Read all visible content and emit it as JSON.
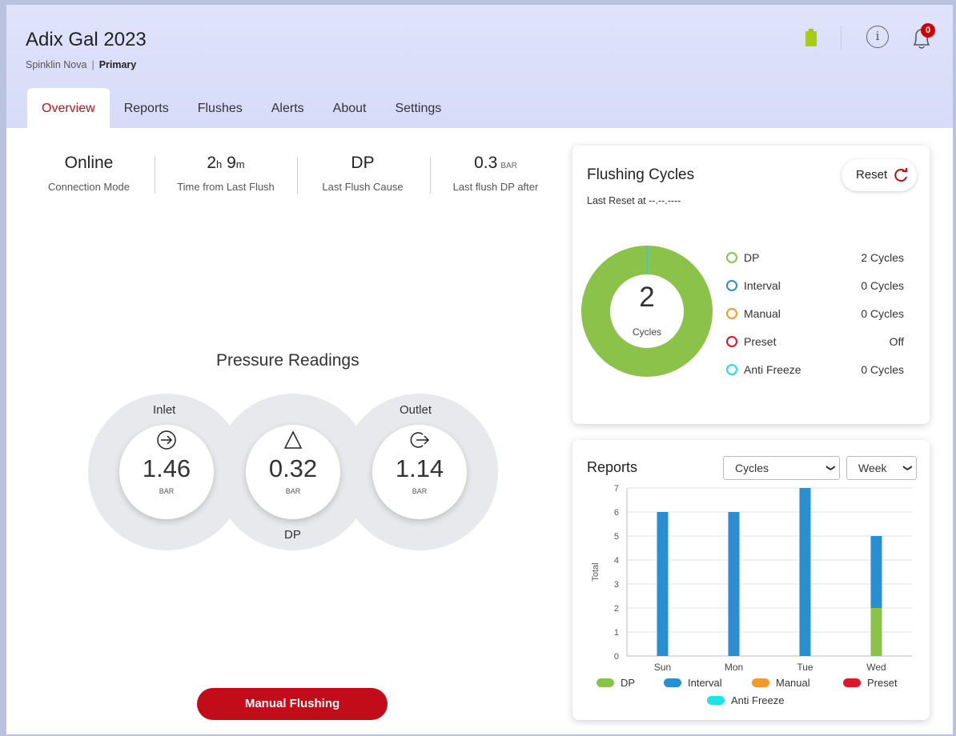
{
  "header": {
    "title": "Adix Gal 2023",
    "subtitle_device": "Spinklin Nova",
    "subtitle_sep": "|",
    "subtitle_role": "Primary",
    "info_glyph": "i",
    "notification_count": "0"
  },
  "tabs": [
    {
      "label": "Overview",
      "active": true
    },
    {
      "label": "Reports"
    },
    {
      "label": "Flushes"
    },
    {
      "label": "Alerts"
    },
    {
      "label": "About"
    },
    {
      "label": "Settings"
    }
  ],
  "stats": {
    "connection": {
      "value": "Online",
      "label": "Connection Mode"
    },
    "last_flush_time": {
      "hours": "2",
      "h_unit": "h",
      "minutes": "9",
      "m_unit": "m",
      "label": "Time from Last Flush"
    },
    "last_flush_cause": {
      "value": "DP",
      "label": "Last Flush Cause"
    },
    "last_flush_dp": {
      "value": "0.3",
      "unit": "BAR",
      "label": "Last flush DP after"
    }
  },
  "pressure": {
    "title": "Pressure Readings",
    "inlet": {
      "label": "Inlet",
      "value": "1.46",
      "unit": "BAR",
      "icon": "arrow-in-circle-icon"
    },
    "dp": {
      "label": "DP",
      "value": "0.32",
      "unit": "BAR",
      "icon": "delta-triangle-icon"
    },
    "outlet": {
      "label": "Outlet",
      "value": "1.14",
      "unit": "BAR",
      "icon": "arrow-out-circle-icon"
    }
  },
  "manual_flush_label": "Manual Flushing",
  "flushing_cycles": {
    "title": "Flushing Cycles",
    "last_reset": "Last Reset at --.--.----",
    "reset_label": "Reset",
    "total": "2",
    "total_label": "Cycles",
    "legend": [
      {
        "name": "DP",
        "value": "2 Cycles",
        "color": "#8bc34a"
      },
      {
        "name": "Interval",
        "value": "0 Cycles",
        "color": "#2a8fd0"
      },
      {
        "name": "Manual",
        "value": "0 Cycles",
        "color": "#f39a2b"
      },
      {
        "name": "Preset",
        "value": "Off",
        "color": "#e0162b"
      },
      {
        "name": "Anti Freeze",
        "value": "0 Cycles",
        "color": "#1de2e8"
      }
    ]
  },
  "reports": {
    "title": "Reports",
    "metric_select": "Cycles",
    "period_select": "Week"
  },
  "chart_data": {
    "type": "bar",
    "stacked": true,
    "categories": [
      "Sun",
      "Mon",
      "Tue",
      "Wed"
    ],
    "series": [
      {
        "name": "DP",
        "color": "#8bc34a",
        "values": [
          0,
          0,
          0,
          2
        ]
      },
      {
        "name": "Interval",
        "color": "#2a8fd0",
        "values": [
          6,
          6,
          7,
          3
        ]
      },
      {
        "name": "Manual",
        "color": "#f39a2b",
        "values": [
          0,
          0,
          0,
          0
        ]
      },
      {
        "name": "Preset",
        "color": "#e0162b",
        "values": [
          0,
          0,
          0,
          0
        ]
      },
      {
        "name": "Anti Freeze",
        "color": "#1de2e8",
        "values": [
          0,
          0,
          0,
          0
        ]
      }
    ],
    "ylabel": "Total",
    "ylim": [
      0,
      7
    ],
    "yticks": [
      "0",
      "1",
      "2",
      "3",
      "4",
      "5",
      "6",
      "7"
    ],
    "grid": true,
    "legend_position": "bottom"
  }
}
